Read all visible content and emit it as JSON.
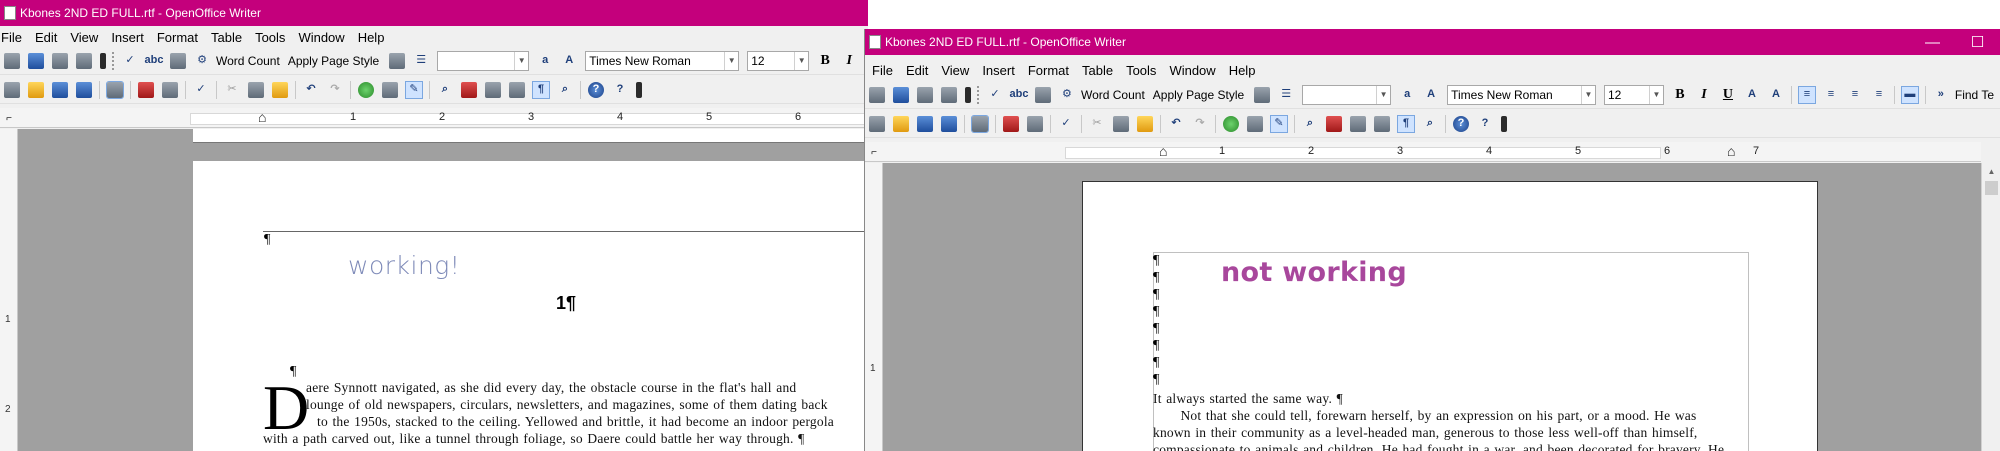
{
  "left_window": {
    "title": "Kbones 2ND ED FULL.rtf - OpenOffice Writer",
    "controls": {
      "minimize": "—",
      "maximize": "☐",
      "close": "✕"
    },
    "menu": [
      "File",
      "Edit",
      "View",
      "Insert",
      "Format",
      "Table",
      "Tools",
      "Window",
      "Help"
    ],
    "toolbar": {
      "word_count": "Word Count",
      "apply_page_style": "Apply Page Style",
      "style_value": "",
      "font_name": "Times New Roman",
      "font_size": "12"
    },
    "ruler_numbers": [
      "1",
      "2",
      "3",
      "4",
      "5",
      "6"
    ],
    "document": {
      "heading_image_text": "working!",
      "page_number": "1¶",
      "pilcrow": "¶",
      "dropcap": "D",
      "lines": [
        "aere Synnott navigated, as she did every day, the obstacle course in the flat's hall and",
        "lounge of old newspapers, circulars, newsletters, and magazines, some of them dating back",
        "to the 1950s, stacked to the ceiling.  Yellowed and brittle, it had become an indoor pergola",
        "with a path carved out, like a tunnel through foliage, so Daere could battle her way through.  ¶"
      ]
    }
  },
  "right_window": {
    "title": "Kbones 2ND ED FULL.rtf - OpenOffice Writer",
    "controls": {
      "minimize": "—",
      "maximize": "☐"
    },
    "menu": [
      "File",
      "Edit",
      "View",
      "Insert",
      "Format",
      "Table",
      "Tools",
      "Window",
      "Help"
    ],
    "toolbar": {
      "word_count": "Word Count",
      "apply_page_style": "Apply Page Style",
      "style_value": "",
      "font_name": "Times New Roman",
      "font_size": "12",
      "find_text": "Find Te"
    },
    "ruler_numbers": [
      "1",
      "2",
      "3",
      "4",
      "5",
      "6",
      "7"
    ],
    "document": {
      "heading_image_text": "not working",
      "pilcrow": "¶",
      "lines": [
        "It always started the same way. ¶",
        "      Not that she could tell, forewarn herself, by an expression on his part, or a mood. He was",
        "known in their community as a level-headed man, generous to those less well-off than himself,",
        "compassionate to animals and children. He had fought in a war, and been decorated for bravery. He"
      ]
    }
  },
  "colors": {
    "titlebar": "#c4007c",
    "workspace": "#a0a0a0",
    "working_text": "#7e8ab8",
    "not_working_text": "#a8479c"
  }
}
